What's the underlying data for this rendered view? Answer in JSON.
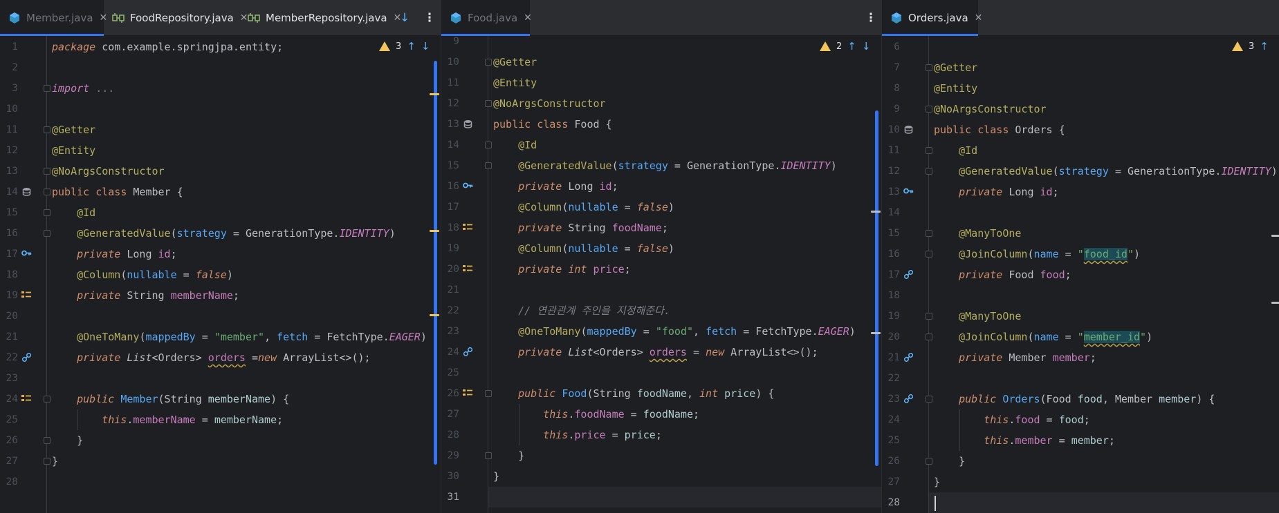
{
  "panes": [
    {
      "tabs": [
        {
          "label": "Member.java",
          "icon": "java-class-icon"
        },
        {
          "label": "FoodRepository.java",
          "icon": "interface-icon"
        },
        {
          "label": "MemberRepository.java",
          "icon": "interface-icon"
        }
      ],
      "inspection": {
        "warnings": "3"
      },
      "lines": [
        {
          "n": "1",
          "html": "<span class='ki'>package</span> <span class='pkg'>com.example.springjpa.entity</span>;"
        },
        {
          "n": "2",
          "html": ""
        },
        {
          "n": "3",
          "html": "<span class='ki' style='color:#c77dbb'>import</span> <span class='cmt' style='font-style:normal'>...</span>"
        },
        {
          "n": "10",
          "html": ""
        },
        {
          "n": "11",
          "html": "<span class='ann'>@Getter</span>"
        },
        {
          "n": "12",
          "html": "<span class='ann'>@Entity</span>"
        },
        {
          "n": "13",
          "html": "<span class='ann'>@NoArgsConstructor</span>"
        },
        {
          "n": "14",
          "html": "<span class='kw'>public class</span> Member {"
        },
        {
          "n": "15",
          "html": "    <span class='ann'>@Id</span>"
        },
        {
          "n": "16",
          "html": "    <span class='ann'>@GeneratedValue</span>(<span class='meth'>strategy</span> = GenerationType.<span class='con'>IDENTITY</span>)"
        },
        {
          "n": "17",
          "html": "    <span class='ki'>private</span> Long <span class='fld'>id</span>;"
        },
        {
          "n": "18",
          "html": "    <span class='ann'>@Column</span>(<span class='meth'>nullable</span> = <span class='ki'>false</span>)"
        },
        {
          "n": "19",
          "html": "    <span class='ki'>private</span> String <span class='fld'>memberName</span>;"
        },
        {
          "n": "20",
          "html": ""
        },
        {
          "n": "21",
          "html": "    <span class='ann'>@OneToMany</span>(<span class='meth'>mappedBy</span> = <span class='str'>\"member\"</span>, <span class='meth'>fetch</span> = FetchType.<span class='con'>EAGER</span>)"
        },
        {
          "n": "22",
          "html": "    <span class='ki'>private</span> <span style='font-style:italic'>List</span>&lt;Orders&gt; <span class='fld wave'>orders</span> =<span class='ki'>new</span> ArrayList&lt;&gt;();"
        },
        {
          "n": "23",
          "html": ""
        },
        {
          "n": "24",
          "html": "    <span class='ki'>public</span> <span class='meth'>Member</span>(String <span style='color:#b0ccd0'>memberName</span>) {"
        },
        {
          "n": "25",
          "html": "        <span class='ki'>this</span>.<span class='fld'>memberName</span> = <span style='color:#b0ccd0'>memberName</span>;"
        },
        {
          "n": "26",
          "html": "    }"
        },
        {
          "n": "27",
          "html": "}"
        },
        {
          "n": "28",
          "html": ""
        }
      ]
    },
    {
      "tabs": [
        {
          "label": "Food.java",
          "icon": "java-class-icon"
        }
      ],
      "inspection": {
        "warnings": "2"
      },
      "lines": [
        {
          "n": "9",
          "html": ""
        },
        {
          "n": "10",
          "html": "<span class='ann'>@Getter</span>"
        },
        {
          "n": "11",
          "html": "<span class='ann'>@Entity</span>"
        },
        {
          "n": "12",
          "html": "<span class='ann'>@NoArgsConstructor</span>"
        },
        {
          "n": "13",
          "html": "<span class='kw'>public class</span> Food {"
        },
        {
          "n": "14",
          "html": "    <span class='ann'>@Id</span>"
        },
        {
          "n": "15",
          "html": "    <span class='ann'>@GeneratedValue</span>(<span class='meth'>strategy</span> = GenerationType.<span class='con'>IDENTITY</span>)"
        },
        {
          "n": "16",
          "html": "    <span class='ki'>private</span> Long <span class='fld'>id</span>;"
        },
        {
          "n": "17",
          "html": "    <span class='ann'>@Column</span>(<span class='meth'>nullable</span> = <span class='ki'>false</span>)"
        },
        {
          "n": "18",
          "html": "    <span class='ki'>private</span> String <span class='fld'>foodName</span>;"
        },
        {
          "n": "19",
          "html": "    <span class='ann'>@Column</span>(<span class='meth'>nullable</span> = <span class='ki'>false</span>)"
        },
        {
          "n": "20",
          "html": "    <span class='ki'>private int</span> <span class='fld'>price</span>;"
        },
        {
          "n": "21",
          "html": ""
        },
        {
          "n": "22",
          "html": "    <span class='cmt'>// 연관관계 주인을 지정해준다.</span>"
        },
        {
          "n": "23",
          "html": "    <span class='ann'>@OneToMany</span>(<span class='meth'>mappedBy</span> = <span class='str'>\"food\"</span>, <span class='meth'>fetch</span> = FetchType.<span class='con'>EAGER</span>)"
        },
        {
          "n": "24",
          "html": "    <span class='ki'>private</span> <span style='font-style:italic'>List</span>&lt;Orders&gt; <span class='fld wave'>orders</span> = <span class='ki'>new</span> ArrayList&lt;&gt;();"
        },
        {
          "n": "25",
          "html": ""
        },
        {
          "n": "26",
          "html": "    <span class='ki'>public</span> <span class='meth'>Food</span>(String <span style='color:#b0ccd0'>foodName</span>, <span class='ki'>int</span> <span style='color:#b0ccd0'>price</span>) {"
        },
        {
          "n": "27",
          "html": "        <span class='ki'>this</span>.<span class='fld'>foodName</span> = <span style='color:#b0ccd0'>foodName</span>;"
        },
        {
          "n": "28",
          "html": "        <span class='ki'>this</span>.<span class='fld'>price</span> = <span style='color:#b0ccd0'>price</span>;"
        },
        {
          "n": "29",
          "html": "    }"
        },
        {
          "n": "30",
          "html": "}"
        },
        {
          "n": "31",
          "html": ""
        }
      ]
    },
    {
      "tabs": [
        {
          "label": "Orders.java",
          "icon": "java-class-icon"
        }
      ],
      "inspection": {
        "warnings": "3"
      },
      "lines": [
        {
          "n": "6",
          "html": ""
        },
        {
          "n": "7",
          "html": "<span class='ann'>@Getter</span>"
        },
        {
          "n": "8",
          "html": "<span class='ann'>@Entity</span>"
        },
        {
          "n": "9",
          "html": "<span class='ann'>@NoArgsConstructor</span>"
        },
        {
          "n": "10",
          "html": "<span class='kw'>public class</span> Orders {"
        },
        {
          "n": "11",
          "html": "    <span class='ann'>@Id</span>"
        },
        {
          "n": "12",
          "html": "    <span class='ann'>@GeneratedValue</span>(<span class='meth'>strategy</span> = GenerationType.<span class='con'>IDENTITY</span>)"
        },
        {
          "n": "13",
          "html": "    <span class='ki'>private</span> Long <span class='fld'>id</span>;"
        },
        {
          "n": "14",
          "html": ""
        },
        {
          "n": "15",
          "html": "    <span class='ann'>@ManyToOne</span>"
        },
        {
          "n": "16",
          "html": "    <span class='ann'>@JoinColumn</span>(<span class='meth'>name</span> = <span class='str'>\"<span class='hlstr wave'>food_id</span>\"</span>)"
        },
        {
          "n": "17",
          "html": "    <span class='ki'>private</span> Food <span class='fld'>food</span>;"
        },
        {
          "n": "18",
          "html": ""
        },
        {
          "n": "19",
          "html": "    <span class='ann'>@ManyToOne</span>"
        },
        {
          "n": "20",
          "html": "    <span class='ann'>@JoinColumn</span>(<span class='meth'>name</span> = <span class='str'>\"<span class='hlstr wave'>member_id</span>\"</span>)"
        },
        {
          "n": "21",
          "html": "    <span class='ki'>private</span> Member <span class='fld'>member</span>;"
        },
        {
          "n": "22",
          "html": ""
        },
        {
          "n": "23",
          "html": "    <span class='ki'>public</span> <span class='meth'>Orders</span>(Food <span style='color:#b0ccd0'>food</span>, Member <span style='color:#b0ccd0'>member</span>) {"
        },
        {
          "n": "24",
          "html": "        <span class='ki'>this</span>.<span class='fld'>food</span> = <span style='color:#b0ccd0'>food</span>;"
        },
        {
          "n": "25",
          "html": "        <span class='ki'>this</span>.<span class='fld'>member</span> = <span style='color:#b0ccd0'>member</span>;"
        },
        {
          "n": "26",
          "html": "    }"
        },
        {
          "n": "27",
          "html": "}"
        },
        {
          "n": "28",
          "html": ""
        }
      ]
    }
  ],
  "colors": {
    "background": "#1e1f22",
    "tabbar": "#2b2d30",
    "accent": "#3574f0",
    "keyword": "#cf8e6d",
    "annotation": "#b3ae60",
    "field": "#c77dbb",
    "string": "#6aab73",
    "method": "#56a8f5",
    "comment": "#7a7e85",
    "warning": "#f2c55c"
  }
}
